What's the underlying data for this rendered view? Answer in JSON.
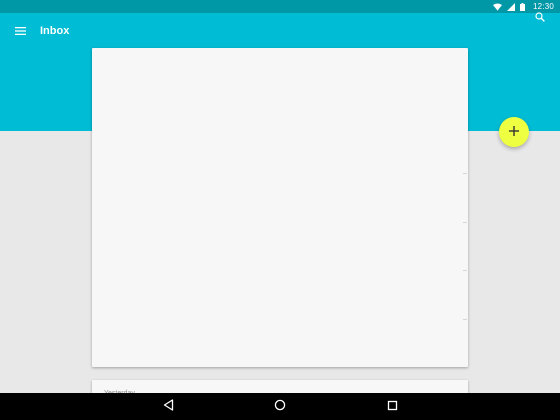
{
  "status_bar": {
    "time": "12:30",
    "icons": [
      "wifi-icon",
      "cell-signal-icon",
      "battery-icon"
    ]
  },
  "toolbar": {
    "title": "Inbox",
    "menu_icon": "menu-icon",
    "search_icon": "search-icon"
  },
  "content": {
    "section_label": "Yesterday"
  },
  "fab": {
    "icon": "plus-icon",
    "color": "#eeff41"
  },
  "nav_bar": {
    "icons": [
      "back-icon",
      "home-icon",
      "recents-icon"
    ]
  },
  "colors": {
    "status_bar": "#0097a7",
    "app_bar": "#00bcd4",
    "background": "#e8e8e8",
    "card": "#f7f7f7",
    "fab": "#eeff41"
  }
}
